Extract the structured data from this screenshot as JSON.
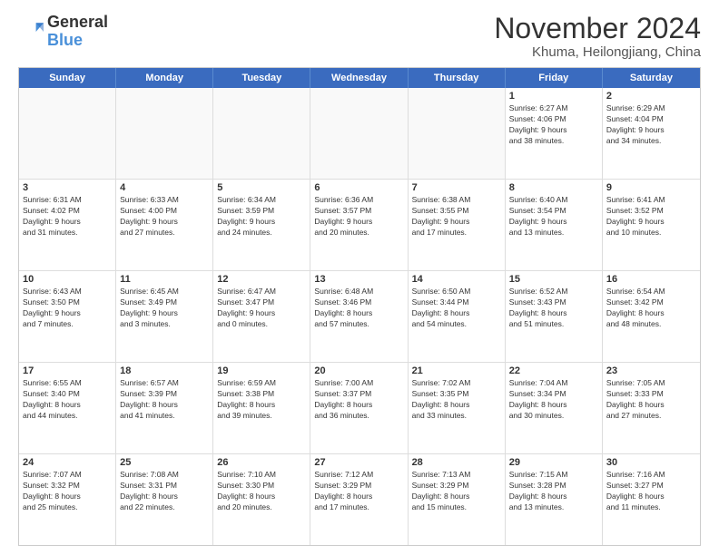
{
  "logo": {
    "line1": "General",
    "line2": "Blue"
  },
  "title": "November 2024",
  "location": "Khuma, Heilongjiang, China",
  "days_header": [
    "Sunday",
    "Monday",
    "Tuesday",
    "Wednesday",
    "Thursday",
    "Friday",
    "Saturday"
  ],
  "weeks": [
    [
      {
        "day": "",
        "info": "",
        "empty": true
      },
      {
        "day": "",
        "info": "",
        "empty": true
      },
      {
        "day": "",
        "info": "",
        "empty": true
      },
      {
        "day": "",
        "info": "",
        "empty": true
      },
      {
        "day": "",
        "info": "",
        "empty": true
      },
      {
        "day": "1",
        "info": "Sunrise: 6:27 AM\nSunset: 4:06 PM\nDaylight: 9 hours\nand 38 minutes.",
        "empty": false
      },
      {
        "day": "2",
        "info": "Sunrise: 6:29 AM\nSunset: 4:04 PM\nDaylight: 9 hours\nand 34 minutes.",
        "empty": false
      }
    ],
    [
      {
        "day": "3",
        "info": "Sunrise: 6:31 AM\nSunset: 4:02 PM\nDaylight: 9 hours\nand 31 minutes.",
        "empty": false
      },
      {
        "day": "4",
        "info": "Sunrise: 6:33 AM\nSunset: 4:00 PM\nDaylight: 9 hours\nand 27 minutes.",
        "empty": false
      },
      {
        "day": "5",
        "info": "Sunrise: 6:34 AM\nSunset: 3:59 PM\nDaylight: 9 hours\nand 24 minutes.",
        "empty": false
      },
      {
        "day": "6",
        "info": "Sunrise: 6:36 AM\nSunset: 3:57 PM\nDaylight: 9 hours\nand 20 minutes.",
        "empty": false
      },
      {
        "day": "7",
        "info": "Sunrise: 6:38 AM\nSunset: 3:55 PM\nDaylight: 9 hours\nand 17 minutes.",
        "empty": false
      },
      {
        "day": "8",
        "info": "Sunrise: 6:40 AM\nSunset: 3:54 PM\nDaylight: 9 hours\nand 13 minutes.",
        "empty": false
      },
      {
        "day": "9",
        "info": "Sunrise: 6:41 AM\nSunset: 3:52 PM\nDaylight: 9 hours\nand 10 minutes.",
        "empty": false
      }
    ],
    [
      {
        "day": "10",
        "info": "Sunrise: 6:43 AM\nSunset: 3:50 PM\nDaylight: 9 hours\nand 7 minutes.",
        "empty": false
      },
      {
        "day": "11",
        "info": "Sunrise: 6:45 AM\nSunset: 3:49 PM\nDaylight: 9 hours\nand 3 minutes.",
        "empty": false
      },
      {
        "day": "12",
        "info": "Sunrise: 6:47 AM\nSunset: 3:47 PM\nDaylight: 9 hours\nand 0 minutes.",
        "empty": false
      },
      {
        "day": "13",
        "info": "Sunrise: 6:48 AM\nSunset: 3:46 PM\nDaylight: 8 hours\nand 57 minutes.",
        "empty": false
      },
      {
        "day": "14",
        "info": "Sunrise: 6:50 AM\nSunset: 3:44 PM\nDaylight: 8 hours\nand 54 minutes.",
        "empty": false
      },
      {
        "day": "15",
        "info": "Sunrise: 6:52 AM\nSunset: 3:43 PM\nDaylight: 8 hours\nand 51 minutes.",
        "empty": false
      },
      {
        "day": "16",
        "info": "Sunrise: 6:54 AM\nSunset: 3:42 PM\nDaylight: 8 hours\nand 48 minutes.",
        "empty": false
      }
    ],
    [
      {
        "day": "17",
        "info": "Sunrise: 6:55 AM\nSunset: 3:40 PM\nDaylight: 8 hours\nand 44 minutes.",
        "empty": false
      },
      {
        "day": "18",
        "info": "Sunrise: 6:57 AM\nSunset: 3:39 PM\nDaylight: 8 hours\nand 41 minutes.",
        "empty": false
      },
      {
        "day": "19",
        "info": "Sunrise: 6:59 AM\nSunset: 3:38 PM\nDaylight: 8 hours\nand 39 minutes.",
        "empty": false
      },
      {
        "day": "20",
        "info": "Sunrise: 7:00 AM\nSunset: 3:37 PM\nDaylight: 8 hours\nand 36 minutes.",
        "empty": false
      },
      {
        "day": "21",
        "info": "Sunrise: 7:02 AM\nSunset: 3:35 PM\nDaylight: 8 hours\nand 33 minutes.",
        "empty": false
      },
      {
        "day": "22",
        "info": "Sunrise: 7:04 AM\nSunset: 3:34 PM\nDaylight: 8 hours\nand 30 minutes.",
        "empty": false
      },
      {
        "day": "23",
        "info": "Sunrise: 7:05 AM\nSunset: 3:33 PM\nDaylight: 8 hours\nand 27 minutes.",
        "empty": false
      }
    ],
    [
      {
        "day": "24",
        "info": "Sunrise: 7:07 AM\nSunset: 3:32 PM\nDaylight: 8 hours\nand 25 minutes.",
        "empty": false
      },
      {
        "day": "25",
        "info": "Sunrise: 7:08 AM\nSunset: 3:31 PM\nDaylight: 8 hours\nand 22 minutes.",
        "empty": false
      },
      {
        "day": "26",
        "info": "Sunrise: 7:10 AM\nSunset: 3:30 PM\nDaylight: 8 hours\nand 20 minutes.",
        "empty": false
      },
      {
        "day": "27",
        "info": "Sunrise: 7:12 AM\nSunset: 3:29 PM\nDaylight: 8 hours\nand 17 minutes.",
        "empty": false
      },
      {
        "day": "28",
        "info": "Sunrise: 7:13 AM\nSunset: 3:29 PM\nDaylight: 8 hours\nand 15 minutes.",
        "empty": false
      },
      {
        "day": "29",
        "info": "Sunrise: 7:15 AM\nSunset: 3:28 PM\nDaylight: 8 hours\nand 13 minutes.",
        "empty": false
      },
      {
        "day": "30",
        "info": "Sunrise: 7:16 AM\nSunset: 3:27 PM\nDaylight: 8 hours\nand 11 minutes.",
        "empty": false
      }
    ]
  ]
}
